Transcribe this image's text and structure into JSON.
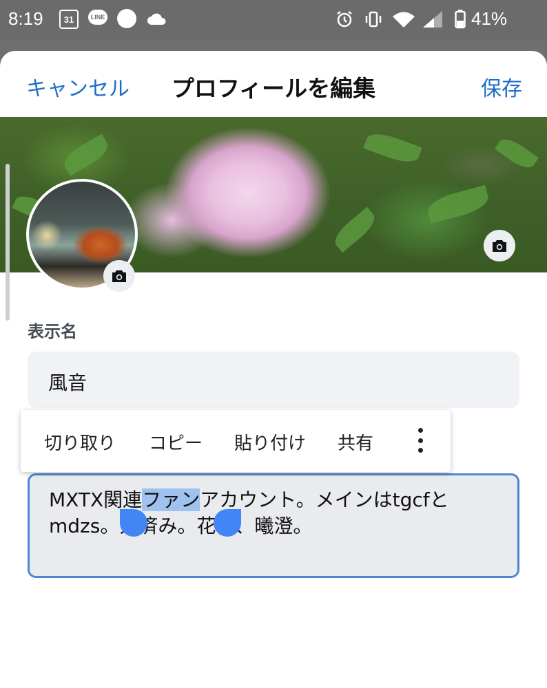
{
  "status_bar": {
    "time": "8:19",
    "calendar_day": "31",
    "line_label": "LINE",
    "battery_percent": "41%",
    "icons": [
      "calendar-icon",
      "line-app-icon",
      "circle-icon",
      "cloud-icon",
      "alarm-icon",
      "vibrate-icon",
      "wifi-icon",
      "signal-icon",
      "battery-icon"
    ]
  },
  "header": {
    "cancel_label": "キャンセル",
    "title": "プロフィールを編集",
    "save_label": "保存"
  },
  "display_name": {
    "label": "表示名",
    "value": "風音"
  },
  "context_menu": {
    "items": [
      "切り取り",
      "コピー",
      "貼り付け",
      "共有"
    ]
  },
  "bio": {
    "line1_before": "MXTX関連",
    "line1_selected": "ファン",
    "line1_after": "アカウント。メインはtgcfと",
    "line2_a": "mdzs。",
    "line2_b": "人済み。",
    "line2_c": "花怜、曦澄。"
  },
  "colors": {
    "accent": "#1f6dc6",
    "focus_border": "#4a86d4",
    "selection": "#9fc2ef",
    "handle": "#4285f4"
  }
}
